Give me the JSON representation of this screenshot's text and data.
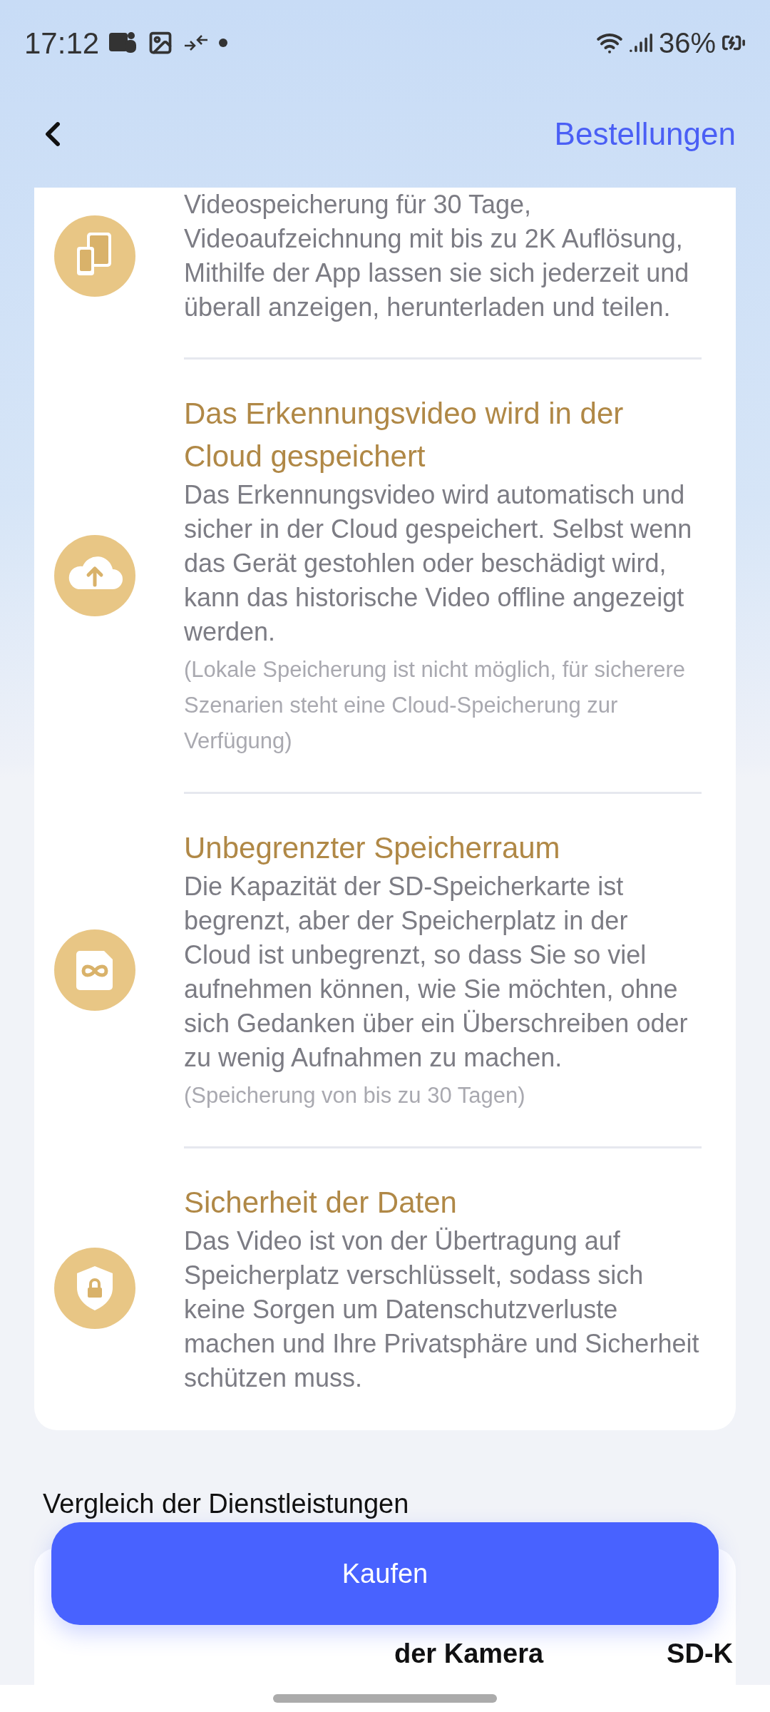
{
  "status_bar": {
    "time": "17:12",
    "battery": "36%"
  },
  "header": {
    "action": "Bestellungen"
  },
  "features": [
    {
      "kind": "devices",
      "body": "Videospeicherung für 30 Tage, Videoaufzeichnung mit bis zu 2K Auflösung, Mithilfe der App lassen sie sich jederzeit und überall anzeigen, herunterladen und teilen."
    },
    {
      "kind": "cloud-upload",
      "title": "Das Erkennungsvideo wird in der Cloud gespeichert",
      "body": "Das Erkennungsvideo wird automatisch und sicher in der Cloud gespeichert. Selbst wenn das Gerät gestohlen oder beschädigt wird, kann das historische Video offline angezeigt werden.",
      "note": "(Lokale Speicherung ist nicht möglich, für sicherere Szenarien steht eine Cloud-Speicherung zur Verfügung)"
    },
    {
      "kind": "infinity-card",
      "title": "Unbegrenzter Speicherraum",
      "body": "Die Kapazität der SD-Speicherkarte ist begrenzt, aber der Speicherplatz in der Cloud ist unbegrenzt, so dass Sie so viel aufnehmen können, wie Sie möchten, ohne sich Gedanken über ein Überschreiben oder zu wenig Aufnahmen zu machen.",
      "note": "(Speicherung von bis zu 30 Tagen)"
    },
    {
      "kind": "shield-lock",
      "title": "Sicherheit der Daten",
      "body": "Das Video ist von der Übertragung auf Speicherplatz verschlüsselt, sodass sich keine Sorgen um Datenschutzverluste machen und Ihre Privatsphäre und Sicherheit schützen muss."
    }
  ],
  "comparison": {
    "title": "Vergleich der Dienstleistungen",
    "columns": [
      "der Kamera",
      "SD-K"
    ]
  },
  "buy_button": "Kaufen"
}
